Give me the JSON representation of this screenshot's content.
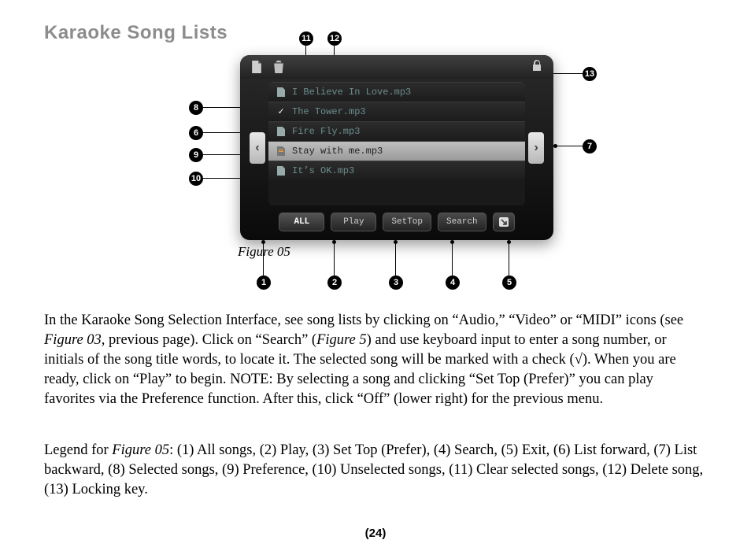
{
  "title": "Karaoke Song Lists",
  "figure_caption": "Figure 05",
  "page_num": "(24)",
  "topbar": {
    "icon1_name": "clear-selected-icon",
    "icon2_name": "delete-icon",
    "lock_name": "lock-icon"
  },
  "arrows": {
    "left": "‹",
    "right": "›"
  },
  "songs": [
    {
      "label": "I Believe In Love.mp3",
      "icon": "doc"
    },
    {
      "label": "The Tower.mp3",
      "icon": "check"
    },
    {
      "label": "Fire Fly.mp3",
      "icon": "doc"
    },
    {
      "label": "Stay with me.mp3",
      "icon": "pref",
      "selected": true
    },
    {
      "label": "It’s OK.mp3",
      "icon": "doc"
    }
  ],
  "buttons": {
    "all": "ALL",
    "play": "Play",
    "settop": "SetTop",
    "search": "Search",
    "exit": "↘"
  },
  "callouts": {
    "1": "1",
    "2": "2",
    "3": "3",
    "4": "4",
    "5": "5",
    "6": "6",
    "7": "7",
    "8": "8",
    "9": "9",
    "10": "10",
    "11": "11",
    "12": "12",
    "13": "13"
  },
  "para1_html": "In the Karaoke Song Selection Interface, see song lists by clicking on “Audio,” “Video” or “MIDI” icons (see <i class='italic'>Figure 03</i>, previous page). Click on “Search” (<i class='italic'>Figure 5</i>) and use keyboard input to enter a song number, or initials of the song title words, to locate it. The selected song will be marked with a check (√). When you are ready, click on “Play” to begin. NOTE: By selecting a song and clicking “Set Top (Prefer)” you can play favorites via the Preference function. After this, click “Off” (lower right) for the previous menu.",
  "para2_html": "Legend for <i class='italic'>Figure 05</i>: (1) All songs, (2) Play, (3) Set Top (Prefer), (4) Search, (5) Exit,  (6) List forward, (7) List backward, (8) Selected songs, (9) Preference, (10) Unselected songs, (11) Clear selected songs, (12) Delete song, (13) Locking key."
}
